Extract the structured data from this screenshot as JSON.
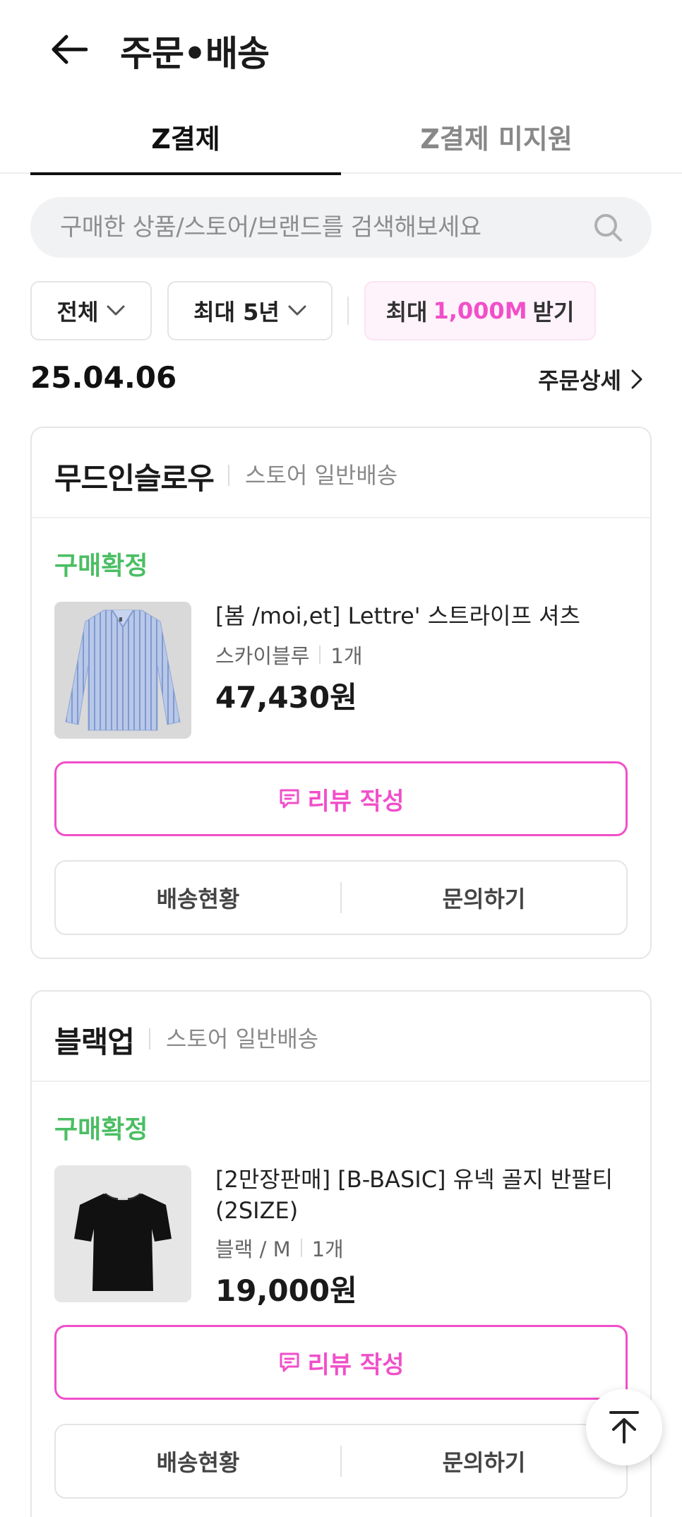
{
  "header": {
    "title": "주문•배송"
  },
  "tabs": [
    {
      "label": "Z결제",
      "active": true
    },
    {
      "label": "Z결제 미지원",
      "active": false
    }
  ],
  "search": {
    "placeholder": "구매한 상품/스토어/브랜드를 검색해보세요"
  },
  "filters": {
    "all_label": "전체",
    "period_label": "최대 5년",
    "promo_prefix": "최대",
    "promo_highlight": "1,000M",
    "promo_suffix": "받기"
  },
  "order": {
    "date": "25.04.06",
    "detail_label": "주문상세"
  },
  "cards": [
    {
      "store": "무드인슬로우",
      "shipping_type": "스토어 일반배송",
      "status": "구매확정",
      "product_name": "[봄 /moi,et] Lettre' 스트라이프 셔츠",
      "option": "스카이블루",
      "quantity": "1개",
      "price": "47,430원",
      "review_label": "리뷰 작성",
      "shipping_status_label": "배송현황",
      "inquiry_label": "문의하기"
    },
    {
      "store": "블랙업",
      "shipping_type": "스토어 일반배송",
      "status": "구매확정",
      "product_name": "[2만장판매] [B-BASIC] 유넥 골지 반팔티 (2SIZE)",
      "option": "블랙 / M",
      "quantity": "1개",
      "price": "19,000원",
      "review_label": "리뷰 작성",
      "shipping_status_label": "배송현황",
      "inquiry_label": "문의하기"
    }
  ],
  "colors": {
    "accent": "#f14fc9",
    "status_green": "#4bbe63",
    "promo_bg": "#fff3fb"
  }
}
